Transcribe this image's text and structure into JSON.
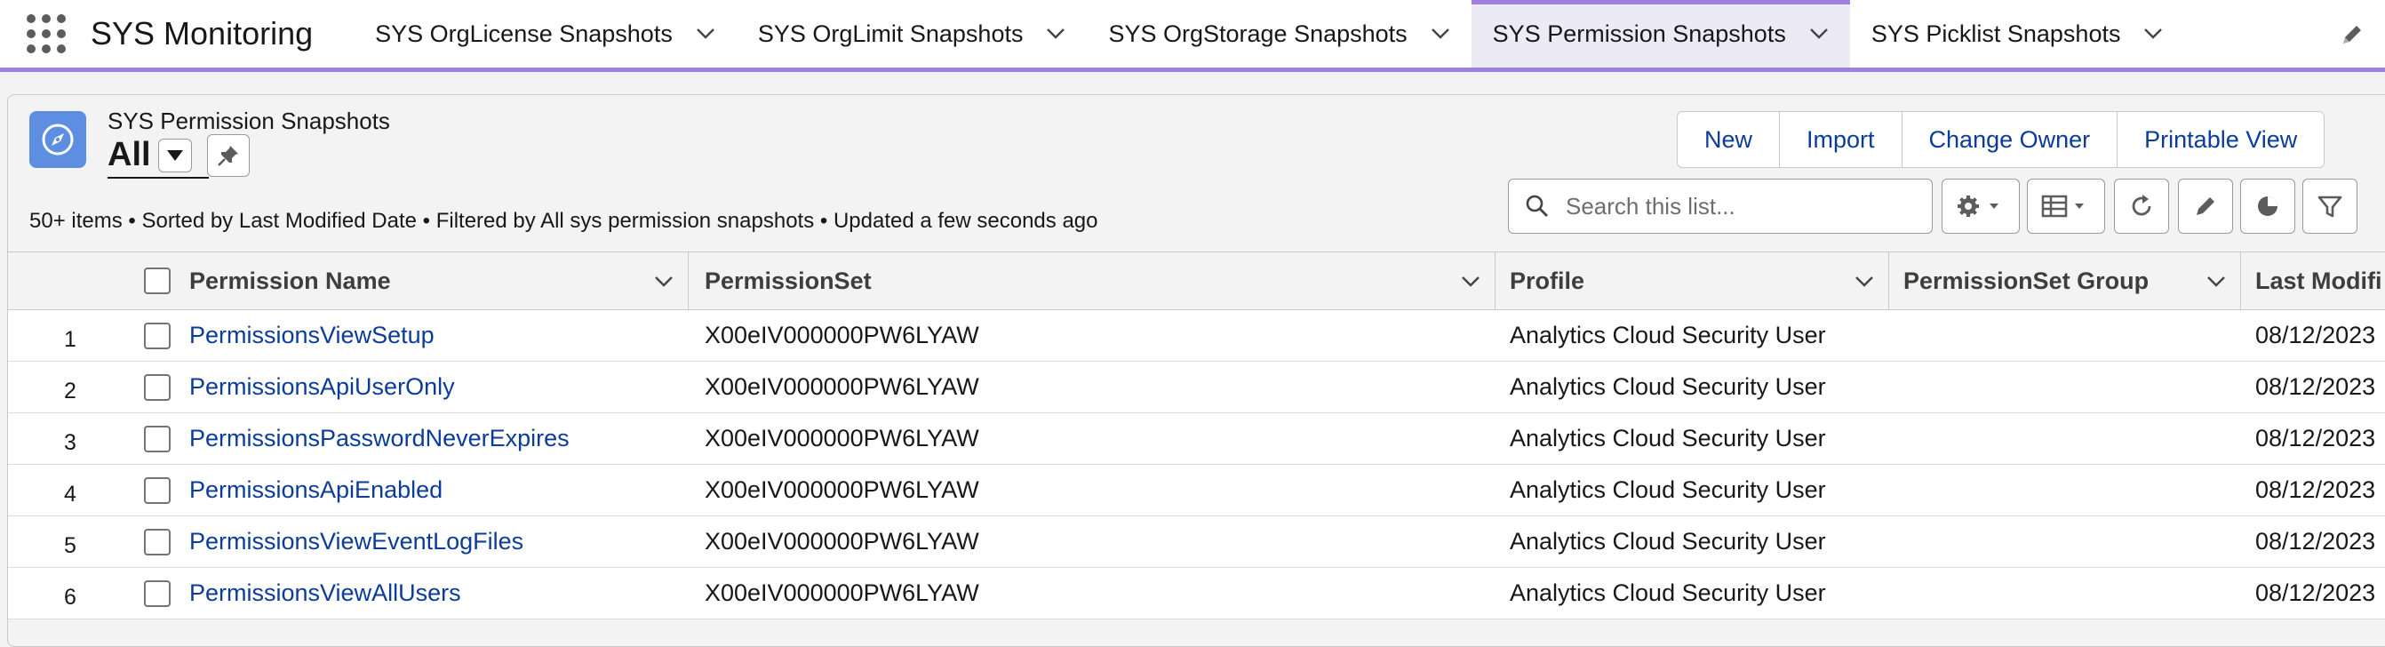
{
  "app": {
    "name": "SYS Monitoring"
  },
  "nav": {
    "tabs": [
      {
        "label": "SYS OrgLicense Snapshots"
      },
      {
        "label": "SYS OrgLimit Snapshots"
      },
      {
        "label": "SYS OrgStorage Snapshots"
      },
      {
        "label": "SYS Permission Snapshots",
        "active": true
      },
      {
        "label": "SYS Picklist Snapshots"
      }
    ]
  },
  "list": {
    "object_label": "SYS Permission Snapshots",
    "view_name": "All",
    "meta": "50+ items • Sorted by Last Modified Date • Filtered by All sys permission snapshots • Updated a few seconds ago",
    "buttons": {
      "new": "New",
      "import": "Import",
      "change_owner": "Change Owner",
      "printable_view": "Printable View"
    },
    "search": {
      "placeholder": "Search this list...",
      "value": ""
    }
  },
  "table": {
    "columns": {
      "name": "Permission Name",
      "permission_set": "PermissionSet",
      "profile": "Profile",
      "permission_set_group": "PermissionSet Group",
      "last_modified": "Last Modifi"
    },
    "rows": [
      {
        "num": "1",
        "name": "PermissionsViewSetup",
        "permission_set": "X00eIV000000PW6LYAW",
        "profile": "Analytics Cloud Security User",
        "group": "",
        "last_modified": "08/12/2023"
      },
      {
        "num": "2",
        "name": "PermissionsApiUserOnly",
        "permission_set": "X00eIV000000PW6LYAW",
        "profile": "Analytics Cloud Security User",
        "group": "",
        "last_modified": "08/12/2023"
      },
      {
        "num": "3",
        "name": "PermissionsPasswordNeverExpires",
        "permission_set": "X00eIV000000PW6LYAW",
        "profile": "Analytics Cloud Security User",
        "group": "",
        "last_modified": "08/12/2023"
      },
      {
        "num": "4",
        "name": "PermissionsApiEnabled",
        "permission_set": "X00eIV000000PW6LYAW",
        "profile": "Analytics Cloud Security User",
        "group": "",
        "last_modified": "08/12/2023"
      },
      {
        "num": "5",
        "name": "PermissionsViewEventLogFiles",
        "permission_set": "X00eIV000000PW6LYAW",
        "profile": "Analytics Cloud Security User",
        "group": "",
        "last_modified": "08/12/2023"
      },
      {
        "num": "6",
        "name": "PermissionsViewAllUsers",
        "permission_set": "X00eIV000000PW6LYAW",
        "profile": "Analytics Cloud Security User",
        "group": "",
        "last_modified": "08/12/2023"
      }
    ]
  },
  "colors": {
    "accent": "#9f7fe0",
    "link": "#0b3c99",
    "object_icon": "#5e8ee2"
  },
  "icons": [
    "app-launcher-icon",
    "chevron-down-icon",
    "edit-icon",
    "compass-icon",
    "pin-icon",
    "search-icon",
    "gear-icon",
    "table-icon",
    "refresh-icon",
    "pencil-icon",
    "chart-icon",
    "filter-icon"
  ]
}
